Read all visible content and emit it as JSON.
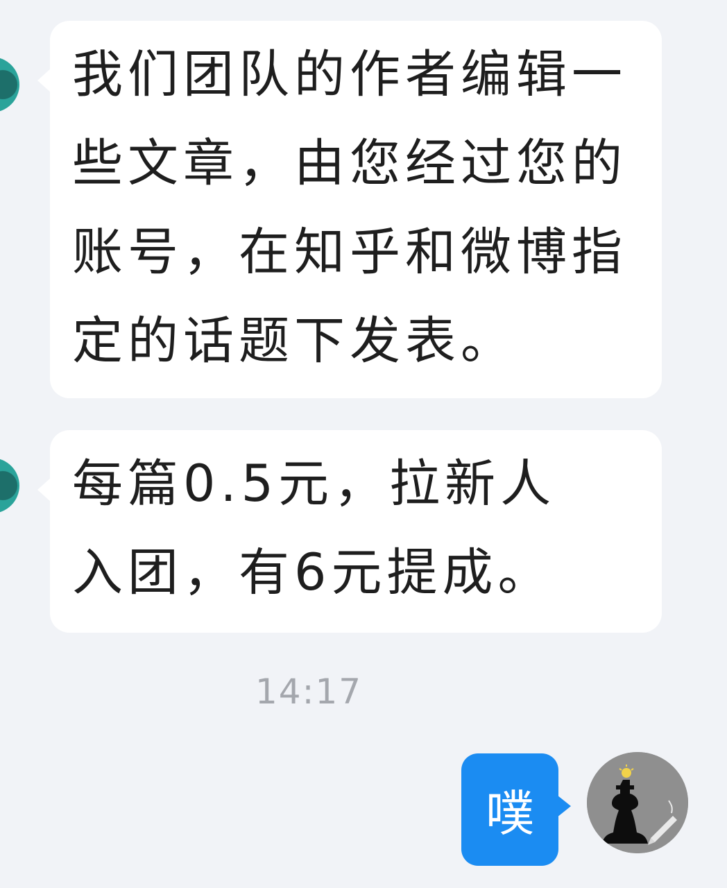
{
  "conversation": {
    "incoming": [
      {
        "text": "我们团队的作者编辑一些文章，由您经过您的账号，在知乎和微博指定的话题下发表。"
      },
      {
        "text": "每篇0.5元，拉新人入团，有6元提成。"
      }
    ],
    "timestamp": "14:17",
    "outgoing": {
      "text": "噗"
    },
    "colors": {
      "background": "#f1f3f7",
      "incoming_bubble": "#ffffff",
      "outgoing_bubble": "#1b8cf2",
      "timestamp_text": "#a4a7ad"
    }
  }
}
